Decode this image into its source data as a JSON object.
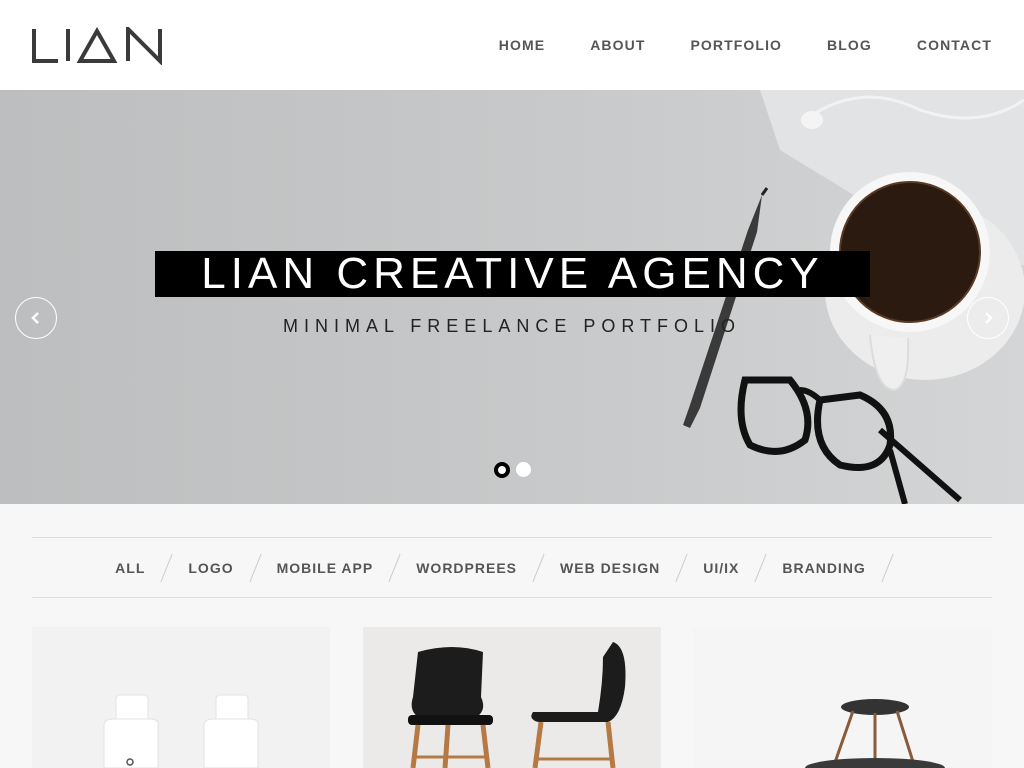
{
  "brand": {
    "logo_text": "LIAN"
  },
  "nav": {
    "items": [
      {
        "label": "HOME"
      },
      {
        "label": "ABOUT"
      },
      {
        "label": "PORTFOLIO"
      },
      {
        "label": "BLOG"
      },
      {
        "label": "CONTACT"
      }
    ]
  },
  "hero": {
    "title": "LIAN CREATIVE AGENCY",
    "subtitle": "MINIMAL FREELANCE PORTFOLIO",
    "slides_total": 2,
    "active_slide": 1,
    "icons": {
      "prev": "chevron-left-icon",
      "next": "chevron-right-icon"
    }
  },
  "filters": {
    "items": [
      {
        "label": "ALL"
      },
      {
        "label": "LOGO"
      },
      {
        "label": "MOBILE APP"
      },
      {
        "label": "WORDPREES"
      },
      {
        "label": "WEB DESIGN"
      },
      {
        "label": "UI/IX"
      },
      {
        "label": "BRANDING"
      }
    ]
  },
  "portfolio": {
    "items": [
      {
        "subject": "white bottles"
      },
      {
        "subject": "black chairs"
      },
      {
        "subject": "side table"
      }
    ]
  },
  "colors": {
    "accent": "#000000",
    "text": "#555555",
    "background": "#f7f7f7"
  }
}
